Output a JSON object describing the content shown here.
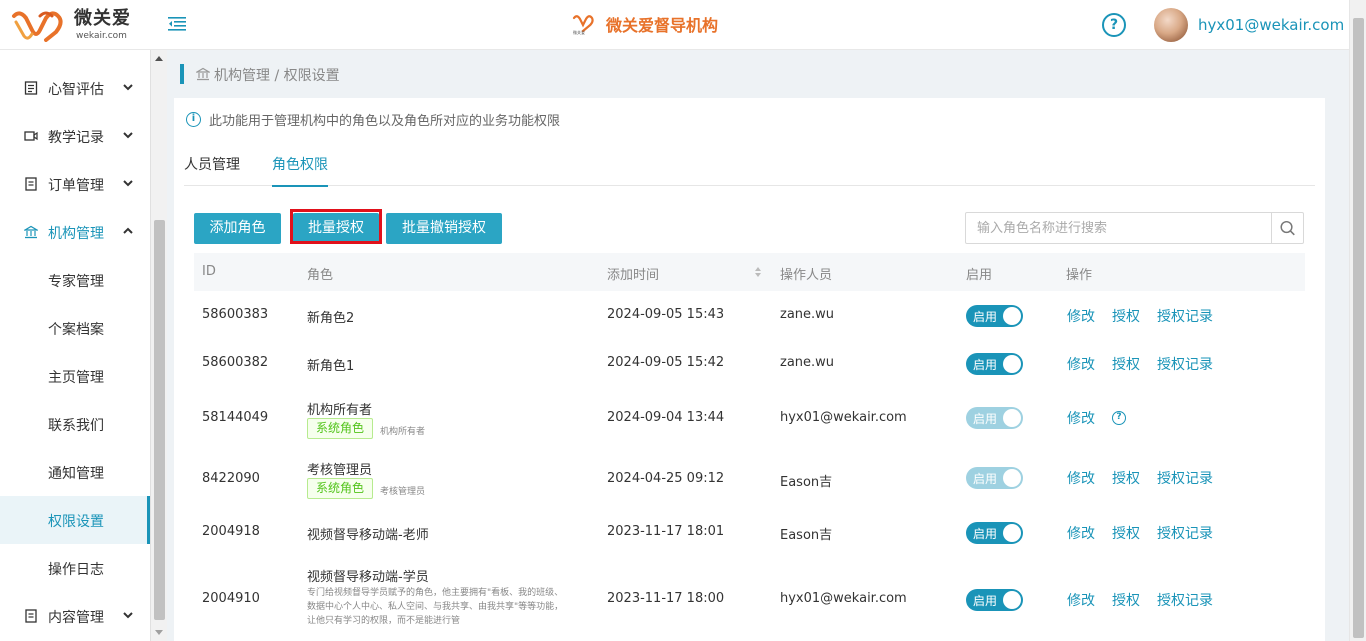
{
  "header": {
    "logo_cn": "微关爱",
    "logo_en": "wekair.com",
    "center_title": "微关爱督导机构",
    "center_mini_logo_text": "微关爱",
    "help_icon": "question-circle-icon",
    "user_email": "hyx01@wekair.com"
  },
  "sidebar": {
    "items": [
      {
        "label": "心智评估",
        "icon": "clipboard-icon",
        "expandable": true
      },
      {
        "label": "教学记录",
        "icon": "video-icon",
        "expandable": true
      },
      {
        "label": "订单管理",
        "icon": "order-icon",
        "expandable": true
      },
      {
        "label": "机构管理",
        "icon": "institution-icon",
        "expandable": true,
        "open": true
      },
      {
        "label": "专家管理"
      },
      {
        "label": "个案档案"
      },
      {
        "label": "主页管理"
      },
      {
        "label": "联系我们"
      },
      {
        "label": "通知管理"
      },
      {
        "label": "权限设置",
        "active": true
      },
      {
        "label": "操作日志"
      },
      {
        "label": "内容管理",
        "icon": "content-icon",
        "expandable": true
      }
    ]
  },
  "breadcrumb": "机构管理 / 权限设置",
  "info_text": "此功能用于管理机构中的角色以及角色所对应的业务功能权限",
  "tabs": [
    {
      "label": "人员管理",
      "active": false
    },
    {
      "label": "角色权限",
      "active": true
    }
  ],
  "toolbar": {
    "add_role": "添加角色",
    "batch_grant": "批量授权",
    "batch_revoke": "批量撤销授权",
    "search_placeholder": "输入角色名称进行搜索"
  },
  "table": {
    "columns": [
      "ID",
      "角色",
      "添加时间",
      "操作人员",
      "启用",
      "操作"
    ],
    "rows": [
      {
        "id": "58600383",
        "role": "新角色2",
        "time": "2024-09-05 15:43",
        "operator": "zane.wu",
        "enabled_label": "启用",
        "enabled": true,
        "disabled_toggle": false,
        "actions": [
          "修改",
          "授权",
          "授权记录"
        ]
      },
      {
        "id": "58600382",
        "role": "新角色1",
        "time": "2024-09-05 15:42",
        "operator": "zane.wu",
        "enabled_label": "启用",
        "enabled": true,
        "disabled_toggle": false,
        "actions": [
          "修改",
          "授权",
          "授权记录"
        ]
      },
      {
        "id": "58144049",
        "role": "机构所有者",
        "tag": "系统角色",
        "tag_note": "机构所有者",
        "time": "2024-09-04 13:44",
        "operator": "hyx01@wekair.com",
        "enabled_label": "启用",
        "enabled": true,
        "disabled_toggle": true,
        "actions": [
          "修改"
        ],
        "extra_icon": "question-circle-icon"
      },
      {
        "id": "8422090",
        "role": "考核管理员",
        "tag": "系统角色",
        "tag_note": "考核管理员",
        "time": "2024-04-25 09:12",
        "operator": "Eason吉",
        "enabled_label": "启用",
        "enabled": true,
        "disabled_toggle": true,
        "actions": [
          "修改",
          "授权",
          "授权记录"
        ]
      },
      {
        "id": "2004918",
        "role": "视频督导移动端-老师",
        "time": "2023-11-17 18:01",
        "operator": "Eason吉",
        "enabled_label": "启用",
        "enabled": true,
        "disabled_toggle": false,
        "actions": [
          "修改",
          "授权",
          "授权记录"
        ]
      },
      {
        "id": "2004910",
        "role": "视频督导移动端-学员",
        "description_lines": [
          "专门给视频督导学员赋予的角色，他主要拥有\"看板、我的班级、",
          "数据中心个人中心、私人空间、与我共享、由我共享\"等等功能，",
          "让他只有学习的权限，而不是能进行管"
        ],
        "time": "2023-11-17 18:00",
        "operator": "hyx01@wekair.com",
        "enabled_label": "启用",
        "enabled": true,
        "disabled_toggle": false,
        "actions": [
          "修改",
          "授权",
          "授权记录"
        ]
      }
    ]
  }
}
